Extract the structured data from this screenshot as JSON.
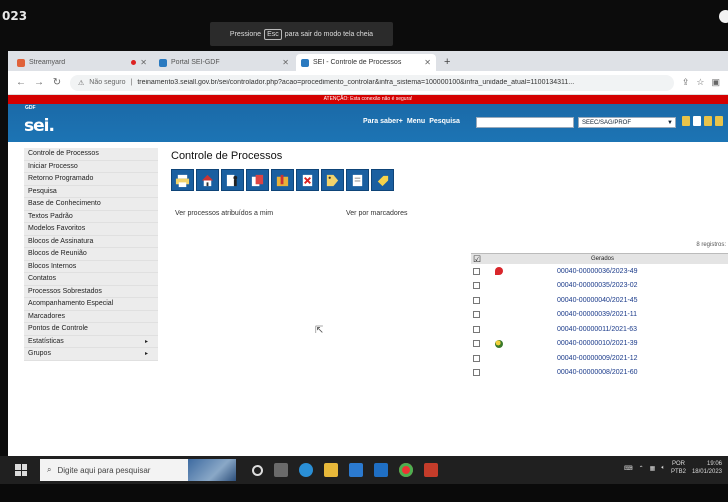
{
  "clock_fragment": "023",
  "fullscreen_notice": {
    "prefix": "Pressione",
    "key": "Esc",
    "suffix": "para sair do modo tela cheia"
  },
  "browser": {
    "tabs": [
      {
        "label": "Streamyard",
        "icon_color": "#e0623a"
      },
      {
        "label": "Portal SEI-GDF",
        "icon_color": "#2a7ac0"
      },
      {
        "label": "SEI - Controle de Processos",
        "icon_color": "#2a7ac0"
      }
    ],
    "address": {
      "security": "Não seguro",
      "url": "treinamento3.seiall.gov.br/sei/controlador.php?acao=procedimento_controlar&infra_sistema=100000100&infra_unidade_atual=1100134311..."
    }
  },
  "sei": {
    "warning": "ATENÇÃO: Esta conexão não é segura!",
    "org": "GDF",
    "logo": "sei.",
    "menu": [
      "Para saber+",
      "Menu",
      "Pesquisa"
    ],
    "unit_select": "SEEC/SAG/PROF",
    "sidebar": [
      "Controle de Processos",
      "Iniciar Processo",
      "Retorno Programado",
      "Pesquisa",
      "Base de Conhecimento",
      "Textos Padrão",
      "Modelos Favoritos",
      "Blocos de Assinatura",
      "Blocos de Reunião",
      "Blocos Internos",
      "Contatos",
      "Processos Sobrestados",
      "Acompanhamento Especial",
      "Marcadores",
      "Pontos de Controle",
      "Estatísticas",
      "Grupos"
    ],
    "sidebar_arrow": "▸",
    "page_title": "Controle de Processos",
    "link_attr": "Ver processos atribuídos a mim",
    "link_marc": "Ver por marcadores",
    "reg_count": "8 registros:",
    "table_header": "Gerados",
    "processes": [
      {
        "num": "00040-00000036/2023-49",
        "icon": "red"
      },
      {
        "num": "00040-00000035/2023-02",
        "icon": ""
      },
      {
        "num": "00040-00000040/2021-45",
        "icon": ""
      },
      {
        "num": "00040-00000039/2021-11",
        "icon": ""
      },
      {
        "num": "00040-00000011/2021-63",
        "icon": ""
      },
      {
        "num": "00040-00000010/2021-39",
        "icon": "person"
      },
      {
        "num": "00040-00000009/2021-12",
        "icon": ""
      },
      {
        "num": "00040-00000008/2021-60",
        "icon": ""
      }
    ]
  },
  "taskbar": {
    "search_placeholder": "Digite aqui para pesquisar",
    "lang_1": "POR",
    "lang_2": "PTB2",
    "time": "19:06",
    "date": "18/01/2023"
  }
}
